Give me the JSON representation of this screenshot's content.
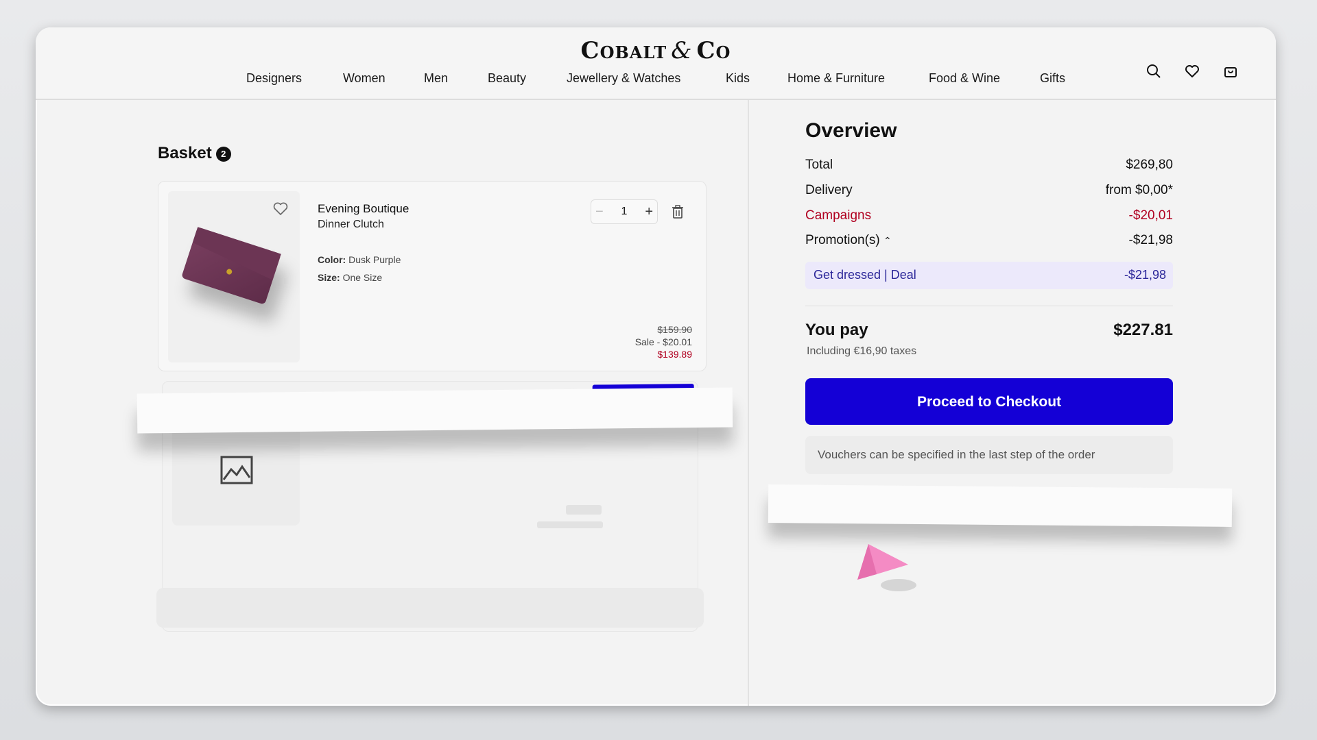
{
  "header": {
    "logo": "Cobalt & Co",
    "logo_parts": [
      "Cobalt",
      "&",
      "Co"
    ],
    "nav": [
      "Designers",
      "Women",
      "Men",
      "Beauty",
      "Jewellery & Watches",
      "Kids",
      "Home & Furniture",
      "Food & Wine",
      "Gifts"
    ],
    "icons": [
      "search-icon",
      "heart-icon",
      "bag-icon"
    ]
  },
  "basket": {
    "title": "Basket",
    "count": "2",
    "item": {
      "brand": "Evening Boutique",
      "name": "Dinner Clutch",
      "color_label": "Color:",
      "color_value": "Dusk Purple",
      "size_label": "Size:",
      "size_value": "One Size",
      "quantity": "1",
      "old_price": "$159.90",
      "sale": "Sale - $20.01",
      "price": "$139.89"
    }
  },
  "overview": {
    "title": "Overview",
    "total_label": "Total",
    "total_value": "$269,80",
    "delivery_label": "Delivery",
    "delivery_value": "from $0,00*",
    "campaigns_label": "Campaigns",
    "campaigns_value": "-$20,01",
    "promotions_label": "Promotion(s)",
    "promotions_value": "-$21,98",
    "promo_name": "Get dressed | Deal",
    "promo_value": "-$21,98",
    "you_pay_label": "You pay",
    "you_pay_value": "$227.81",
    "tax_note": "Including €16,90 taxes",
    "checkout_label": "Proceed to Checkout",
    "voucher_note": "Vouchers can be specified in the last step of the order"
  },
  "colors": {
    "accent": "#1400d6",
    "discount_red": "#b00020",
    "promo_bg": "#ece9fb",
    "cursor": "#f48bc4"
  }
}
